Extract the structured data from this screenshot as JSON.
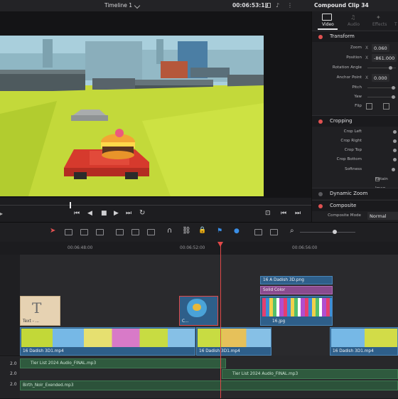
{
  "topbar": {
    "timeline_name": "Timeline 1",
    "timecode": "00:06:53:13",
    "inspector_title": "Compound Clip 34"
  },
  "inspector": {
    "tabs": [
      {
        "label": "Video",
        "active": true
      },
      {
        "label": "Audio",
        "active": false
      },
      {
        "label": "Effects",
        "active": false
      },
      {
        "label": "T",
        "active": false
      }
    ],
    "transform": {
      "title": "Transform",
      "zoom_label": "Zoom",
      "zoom_x": "0.060",
      "position_label": "Position",
      "position_x": "-861.000",
      "rotation_label": "Rotation Angle",
      "anchor_label": "Anchor Point",
      "anchor_x": "0.000",
      "pitch_label": "Pitch",
      "yaw_label": "Yaw",
      "flip_label": "Flip"
    },
    "cropping": {
      "title": "Cropping",
      "rows": [
        "Crop Left",
        "Crop Right",
        "Crop Top",
        "Crop Bottom",
        "Softness"
      ],
      "retain_label": "Retain Imag"
    },
    "dynamic_zoom": {
      "title": "Dynamic Zoom"
    },
    "composite": {
      "title": "Composite",
      "mode_label": "Composite Mode",
      "mode_value": "Normal"
    },
    "accent_color": "#e05151"
  },
  "timeline": {
    "ruler": [
      "00:06:48:00",
      "00:06:52:00",
      "00:06:56:00"
    ],
    "clips": {
      "text_clip": "Text - ...",
      "compound_small": "C...",
      "dadish_png": "16 A Dadish 3D.png",
      "solid_color": "Solid Color",
      "jpg": "16.jpg",
      "dadish_mp4_a": "16 Dadish 3D1.mp4",
      "dadish_mp4_b": "16 Dadish 3D1.mp4",
      "dadish_mp4_c": "16 Dadish 3D1.mp4"
    },
    "audio": {
      "a1_volume": "2.0",
      "a1_clip": "Tier List 2024 Audio_FINAL.mp3",
      "a2_volume": "2.0",
      "a2_clip": "Tier List 2024 Audio_FINAL.mp3",
      "a3_volume": "2.0",
      "a3_clip": "Birth_Noir_Exended.mp3"
    },
    "playhead_color": "#e04848"
  }
}
